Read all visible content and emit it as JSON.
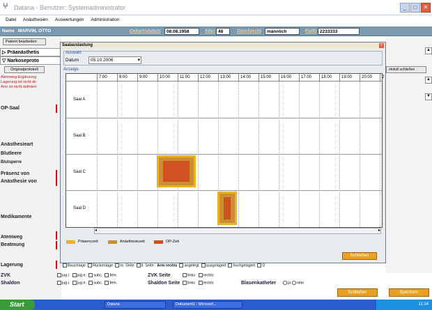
{
  "window": {
    "title": "Datana - Benutzer: Systemadministrator"
  },
  "menu": [
    "Datei",
    "Anästhesien",
    "Auswertungen",
    "Administration"
  ],
  "patient": {
    "name_label": "Name",
    "name_value": "MARVIN, OTTO",
    "birth_label": "Geburtsdatum",
    "birth_value": "08.08.1958",
    "age_label": "Alter",
    "age_value": "48",
    "sex_label": "Geschlecht",
    "sex_value": "männlich",
    "patid_label": "PatID",
    "patid_value": "2233333"
  },
  "left": {
    "edit_patient": "Patient bearbeiten",
    "praeanaesthesie": "Präanästhetis",
    "narkoseproto": "Narkoseproto",
    "original_btn": "Originalprotokoll",
    "warnings": [
      "Atemweg-Ergänzung",
      "Lagerung ist nicht de",
      "Arm ist nicht definiert"
    ],
    "labels": [
      "OP-Saal",
      "Anästhesieart",
      "Blutleere",
      "Blutsperre",
      "Präsenz von",
      "Anästhesie von",
      "Medikamente",
      "Atemweg",
      "Beatmung",
      "Lagerung",
      "ZVK",
      "Shaldon"
    ]
  },
  "right": {
    "protocol_close": "otokoll schließen"
  },
  "dialog": {
    "title": "Saalauslastung",
    "group_label": "Auswahl",
    "date_label": "Datum",
    "date_value": "05.10.2006",
    "display_label": "Anzeige",
    "hours": [
      "7:00",
      "8:00",
      "9:00",
      "10:00",
      "11:00",
      "12:00",
      "13:00",
      "14:00",
      "15:00",
      "16:00",
      "17:00",
      "18:00",
      "19:00",
      "20:00",
      "2"
    ],
    "rooms": [
      "Saal A",
      "Saal B",
      "Saal C",
      "Saal D"
    ],
    "legend": [
      "Präsenzzeit",
      "Anästhesiezeit",
      "OP-Zeit"
    ],
    "close_btn": "Schließen"
  },
  "colors": {
    "praesenz": "#f0b020",
    "anaesthesie": "#c89030",
    "op": "#d05020"
  },
  "bottom": {
    "zvk_options": [
      "jug.i.",
      "jug.e.",
      "subc.",
      "fem."
    ],
    "zvk_seite": "ZVK Seite",
    "shaldon_seite": "Shaldon Seite",
    "seite_options": [
      "links",
      "rechts"
    ],
    "blasenkatheter": "Blasenkatheter",
    "ja": "ja",
    "nein": "nein",
    "lagerung_options": [
      "Bauchlage",
      "Rückenlage",
      "re. Seite",
      "li. Seite"
    ],
    "arm_rechts": "Arm rechts",
    "arm_options": [
      "angelegt",
      "ausgelagert",
      "hochgelagert",
      "Ü"
    ],
    "schliessen": "Schließen",
    "speichern": "Speichern"
  },
  "taskbar": {
    "start": "Start",
    "item1": "Datana",
    "item2": "Dokument1 - Microsof...",
    "clock": "11:14"
  }
}
